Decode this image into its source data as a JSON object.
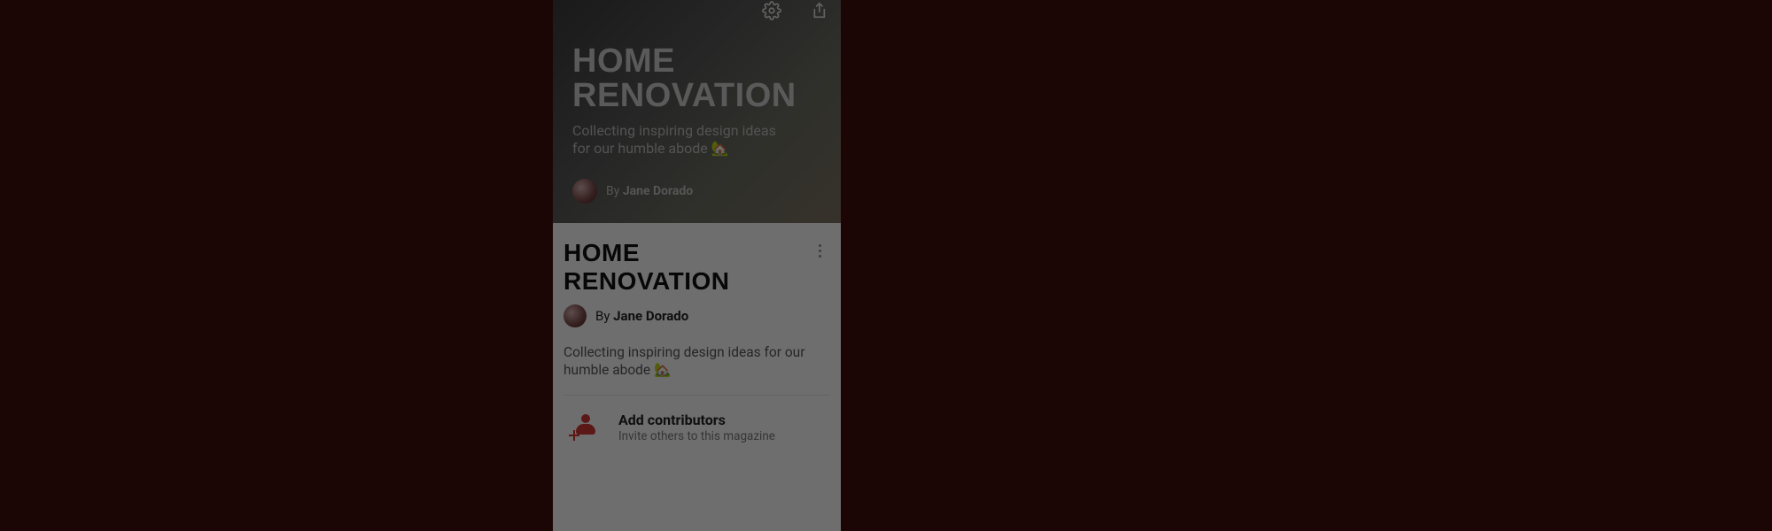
{
  "hero": {
    "title": "HOME RENOVATION",
    "description": "Collecting inspiring design ideas for our humble abode 🏡",
    "by_label": "By ",
    "author": "Jane Dorado"
  },
  "section": {
    "title": "HOME RENOVATION",
    "by_label": "By ",
    "author": "Jane Dorado",
    "description": "Collecting inspiring design ideas for our humble abode 🏡"
  },
  "contributors": {
    "title": "Add contributors",
    "subtitle": "Invite others to this magazine"
  },
  "icons": {
    "settings": "gear-icon",
    "share": "share-icon",
    "more": "more-icon",
    "add_person": "add-person-icon"
  }
}
